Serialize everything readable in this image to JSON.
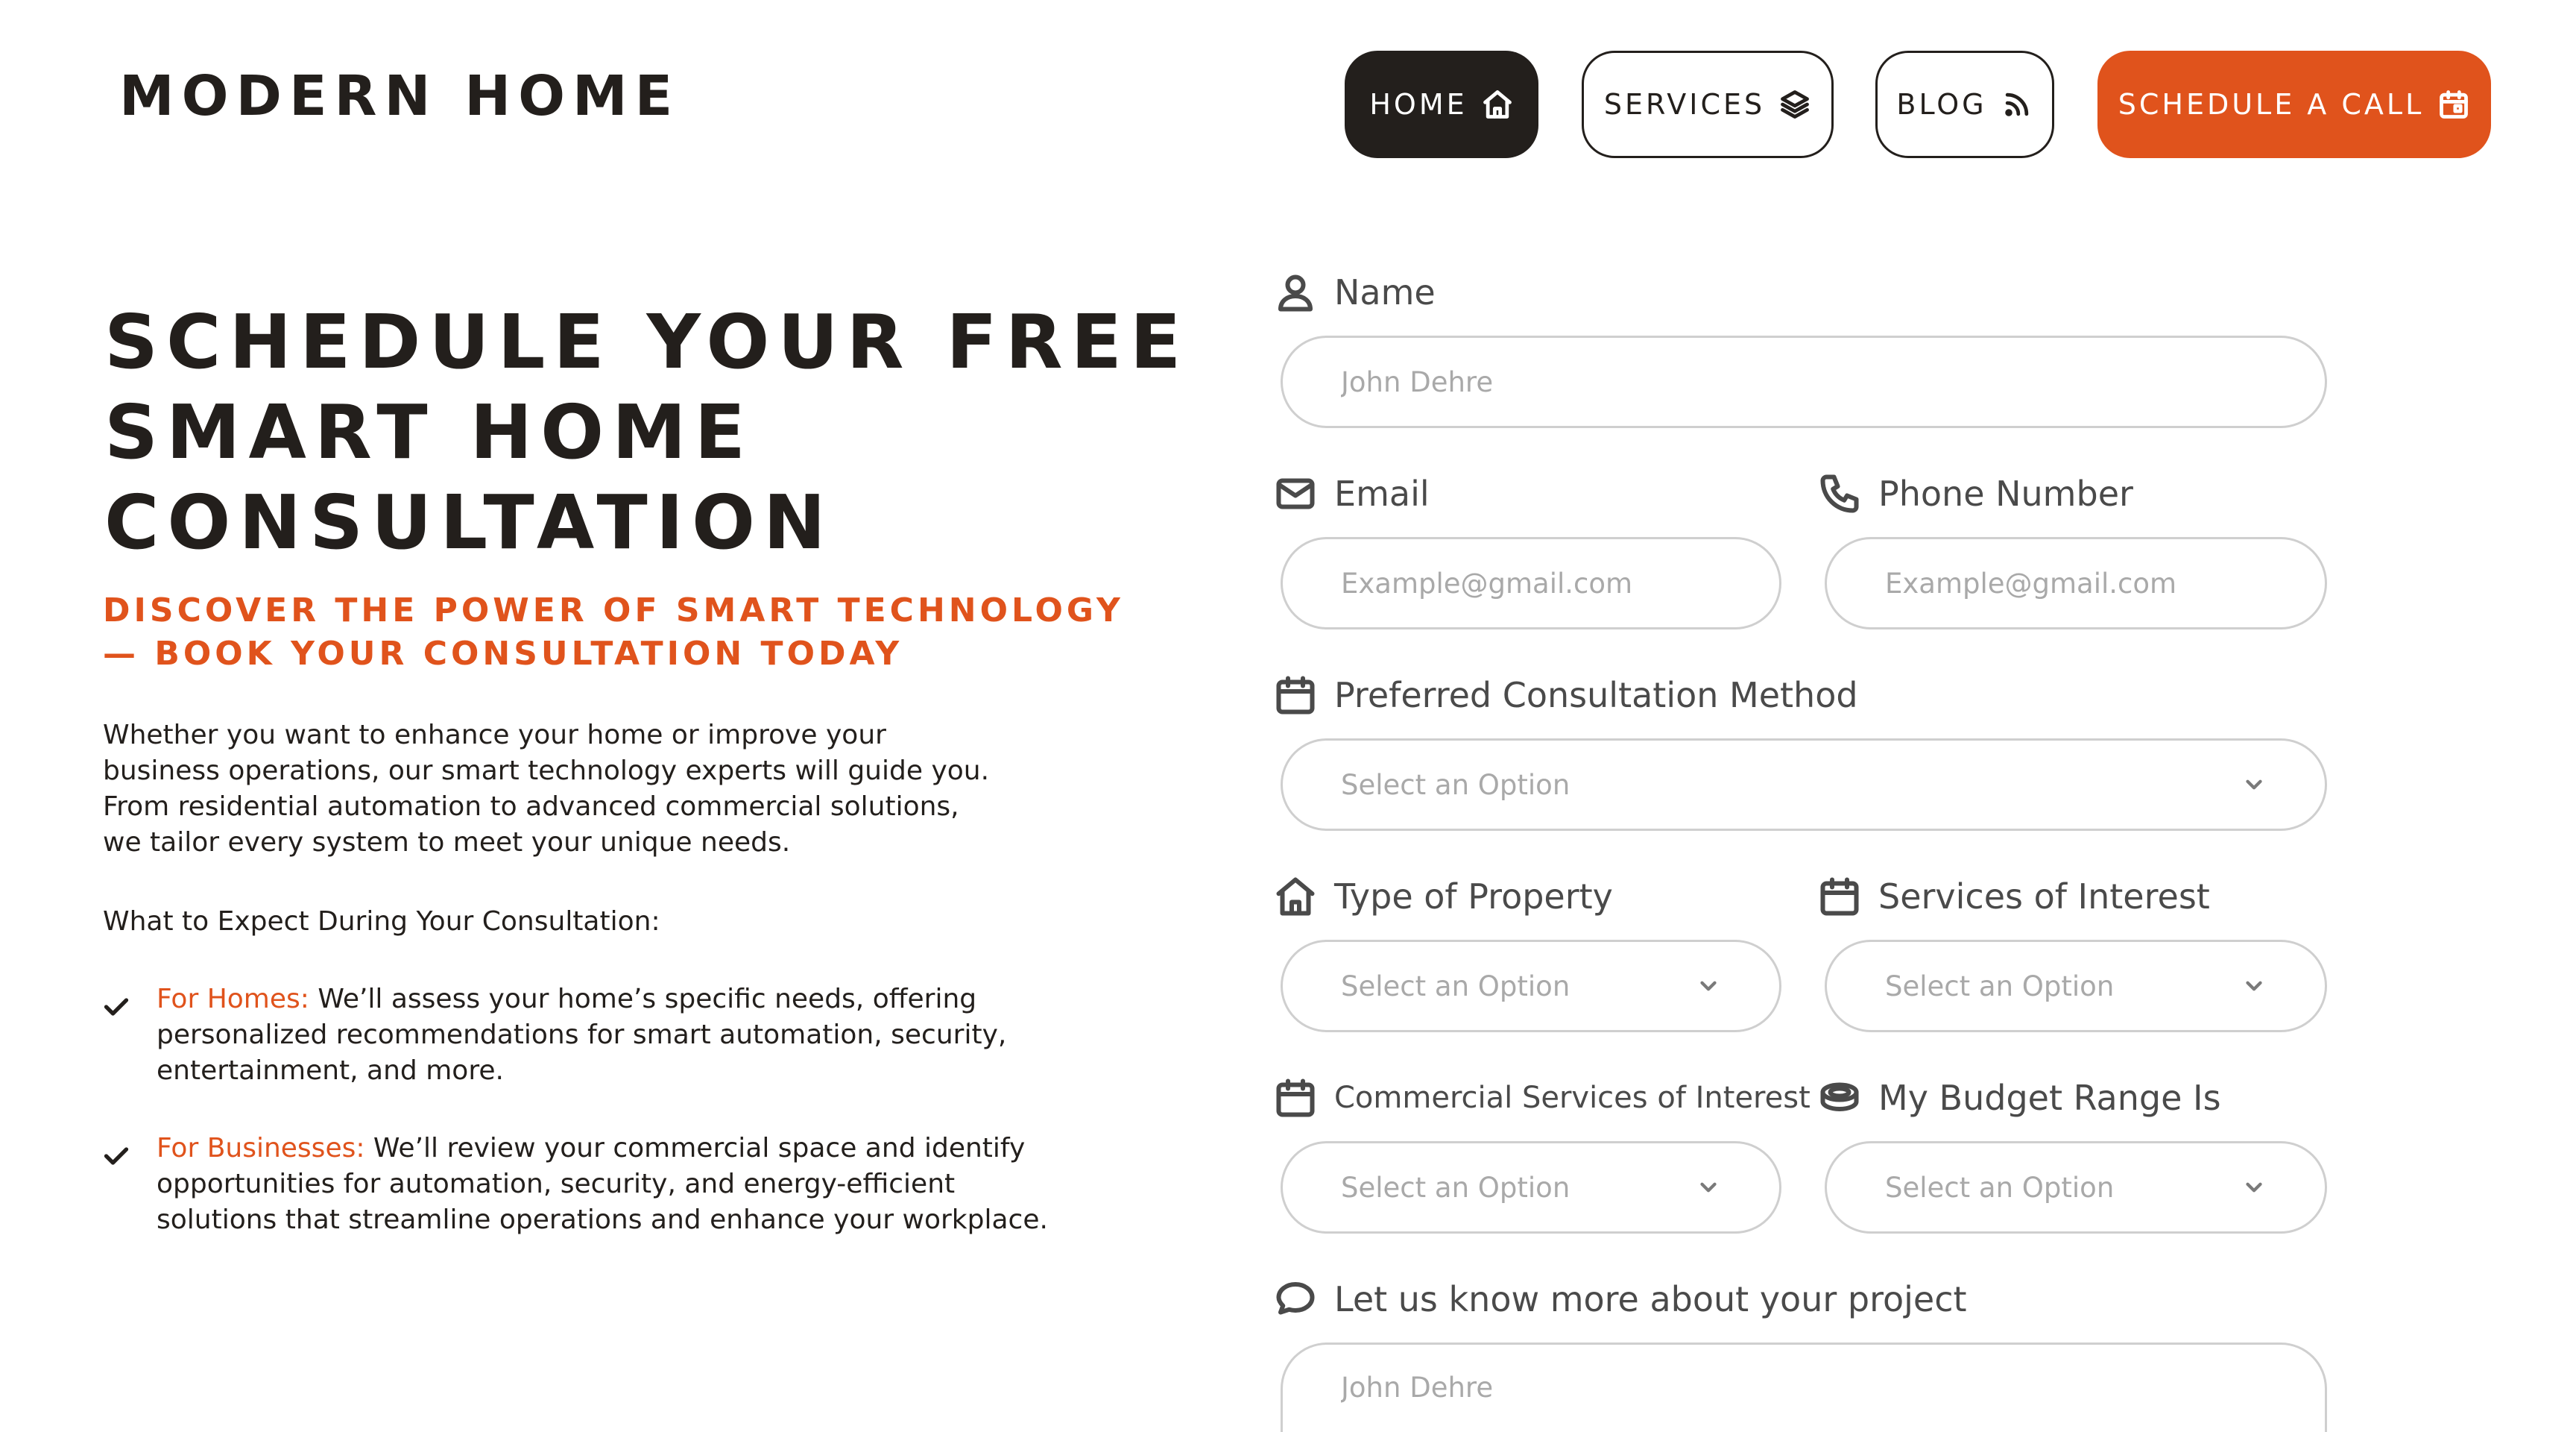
{
  "brand": {
    "logo_text": "MODERN HOME"
  },
  "nav": {
    "items": [
      {
        "label": "HOME",
        "icon": "home-icon"
      },
      {
        "label": "SERVICES",
        "icon": "layers-icon"
      },
      {
        "label": "BLOG",
        "icon": "rss-icon"
      }
    ],
    "cta": {
      "label": "SCHEDULE A CALL",
      "icon": "calendar-icon"
    }
  },
  "hero": {
    "title_lines": [
      "SCHEDULE YOUR FREE",
      "SMART HOME",
      "CONSULTATION"
    ],
    "subtitle_lines": [
      "DISCOVER THE POWER OF SMART TECHNOLOGY",
      "— BOOK YOUR CONSULTATION TODAY"
    ],
    "description_lines": [
      "Whether you want to enhance your home or improve your",
      "business operations, our smart technology experts will guide you.",
      "From residential automation to advanced commercial solutions,",
      "we tailor every system to meet your unique needs."
    ],
    "expect_heading": "What to Expect During Your Consultation:",
    "expect_items": [
      {
        "label": "For Homes:",
        "lines": [
          " We’ll assess your home’s specific needs, offering",
          "personalized recommendations for smart automation, security,",
          "entertainment, and more."
        ]
      },
      {
        "label": "For Businesses:",
        "lines": [
          " We’ll review your commercial space and identify",
          "opportunities for automation, security, and energy-efficient",
          "solutions that streamline operations and enhance your workplace."
        ]
      }
    ]
  },
  "form": {
    "name": {
      "label": "Name",
      "placeholder": "John Dehre",
      "icon": "user-icon"
    },
    "email": {
      "label": "Email",
      "placeholder": "Example@gmail.com",
      "icon": "mail-icon"
    },
    "phone": {
      "label": "Phone Number",
      "placeholder": "Example@gmail.com",
      "icon": "phone-icon"
    },
    "method": {
      "label": "Preferred Consultation Method",
      "value": "Select an Option",
      "icon": "calendar-icon"
    },
    "property": {
      "label": "Type of Property",
      "value": "Select an Option",
      "icon": "home-icon"
    },
    "services": {
      "label": "Services of Interest",
      "value": "Select an Option",
      "icon": "calendar-icon"
    },
    "commercial": {
      "label": "Commercial Services of Interest",
      "value": "Select an Option",
      "icon": "calendar-icon"
    },
    "budget": {
      "label": "My Budget Range Is",
      "value": "Select an Option",
      "icon": "coins-icon"
    },
    "project": {
      "label": "Let us know more about your project",
      "placeholder": "John Dehre",
      "icon": "chat-icon"
    }
  },
  "colors": {
    "accent": "#e0531c",
    "dark": "#231f1c",
    "border": "#cfcfcf",
    "placeholder": "#a9a9a9"
  }
}
